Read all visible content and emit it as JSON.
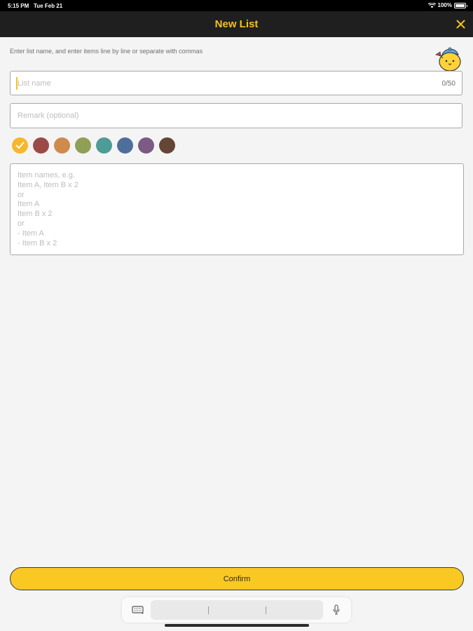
{
  "status_bar": {
    "time": "5:15 PM",
    "date": "Tue Feb 21",
    "battery": "100%",
    "icons": [
      "wifi-icon",
      "battery-icon"
    ]
  },
  "nav": {
    "title": "New List",
    "close_icon": "close-icon"
  },
  "instructions": "Enter list name, and enter items line by line or separate with commas",
  "name_field": {
    "placeholder": "List name",
    "counter": "0/50"
  },
  "remark_field": {
    "placeholder": "Remark (optional)"
  },
  "color_options": [
    {
      "name": "yellow",
      "color": "#f6b72c",
      "selected": true
    },
    {
      "name": "red",
      "color": "#9c4a48",
      "selected": false
    },
    {
      "name": "orange",
      "color": "#cf8a4c",
      "selected": false
    },
    {
      "name": "olive",
      "color": "#8f9f55",
      "selected": false
    },
    {
      "name": "teal",
      "color": "#4f9b95",
      "selected": false
    },
    {
      "name": "blue",
      "color": "#4f6f9b",
      "selected": false
    },
    {
      "name": "purple",
      "color": "#7b5a84",
      "selected": false
    },
    {
      "name": "brown",
      "color": "#654536",
      "selected": false
    }
  ],
  "items_field": {
    "placeholder_lines": [
      "Item names, e.g.",
      "Item A, Item B x 2",
      "or",
      "Item A",
      "Item B x 2",
      "or",
      "- Item A",
      "- Item B x 2"
    ]
  },
  "confirm_label": "Confirm",
  "keyboard_bar": {
    "icons": [
      "keyboard-icon",
      "microphone-icon"
    ]
  },
  "colors": {
    "accent": "#f9c823",
    "nav_bg": "#1f1f1f",
    "title": "#f5c022"
  }
}
